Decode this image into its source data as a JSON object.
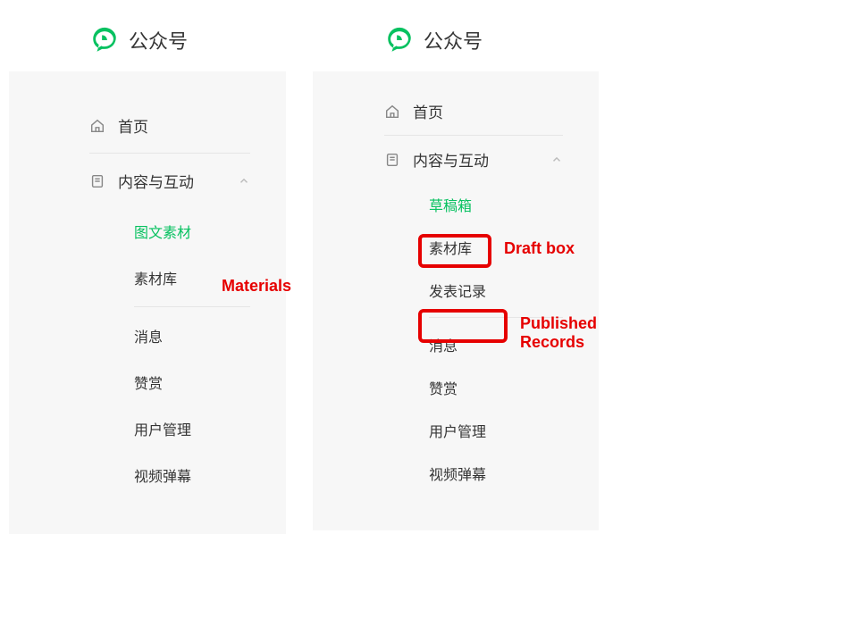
{
  "brand": "公众号",
  "left": {
    "home": "首页",
    "content_section": "内容与互动",
    "subitems": {
      "materials": "图文素材",
      "library": "素材库",
      "messages": "消息",
      "appreciation": "赞赏",
      "user_mgmt": "用户管理",
      "video_barrage": "视频弹幕"
    }
  },
  "right": {
    "home": "首页",
    "content_section": "内容与互动",
    "subitems": {
      "drafts": "草稿箱",
      "library": "素材库",
      "publish_records": "发表记录",
      "messages": "消息",
      "appreciation": "赞赏",
      "user_mgmt": "用户管理",
      "video_barrage": "视频弹幕"
    }
  },
  "annotations": {
    "materials": "Materials",
    "draft_box": "Draft box",
    "published_records": "Published Records"
  }
}
